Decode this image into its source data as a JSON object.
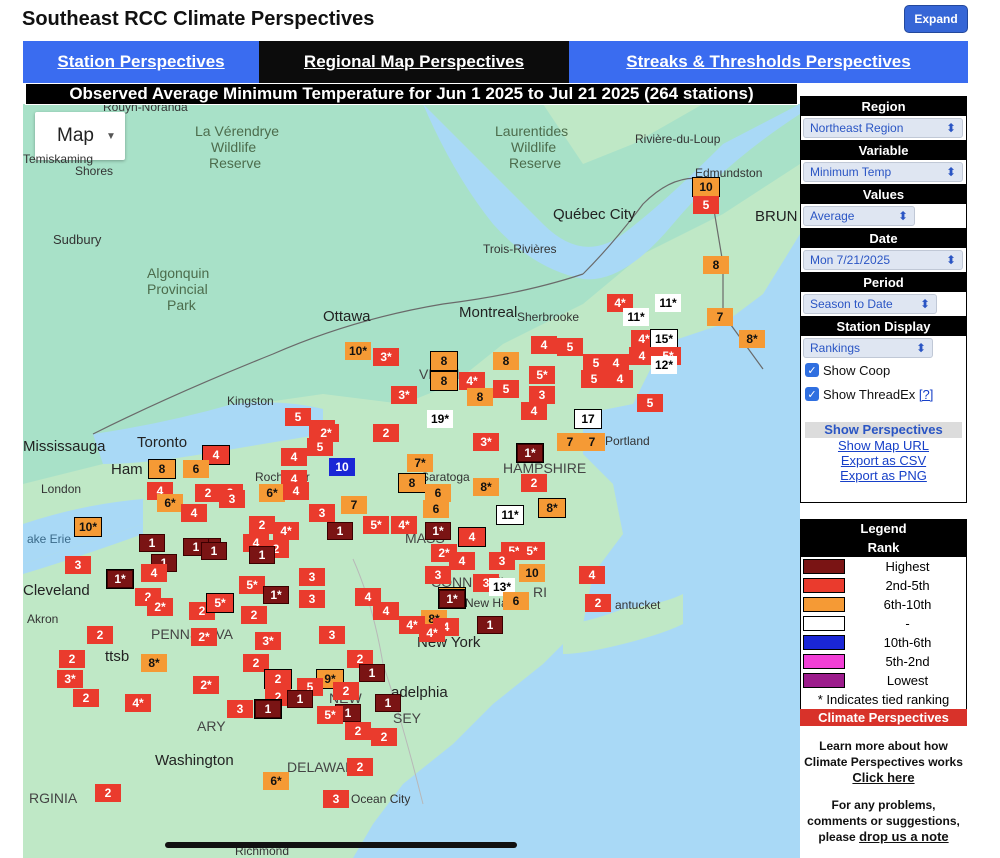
{
  "app": {
    "title": "Southeast RCC Climate Perspectives",
    "expand_label": "Expand"
  },
  "tabs": [
    {
      "label": "Station Perspectives",
      "active": false
    },
    {
      "label": "Regional Map Perspectives",
      "active": true
    },
    {
      "label": "Streaks & Thresholds Perspectives",
      "active": false
    }
  ],
  "map": {
    "title": "Observed Average Minimum Temperature for Jun 1 2025 to Jul 21 2025 (264 stations)",
    "map_type": "Map",
    "places": [
      {
        "label": "La Vérendrye",
        "type": "park"
      },
      {
        "label": "Wildlife",
        "type": "park"
      },
      {
        "label": "Reserve",
        "type": "park"
      },
      {
        "label": "Laurentides",
        "type": "park"
      },
      {
        "label": "Wildlife",
        "type": "park"
      },
      {
        "label": "Reserve",
        "type": "park"
      },
      {
        "label": "Algonquin",
        "type": "park"
      },
      {
        "label": "Provincial",
        "type": "park"
      },
      {
        "label": "Park",
        "type": "park"
      },
      {
        "label": "Rouyn-Noranda",
        "type": "place"
      },
      {
        "label": "Temiskaming",
        "type": "place"
      },
      {
        "label": "Shores",
        "type": "place"
      },
      {
        "label": "Rivière-du-Loup",
        "type": "place"
      },
      {
        "label": "Edmundston",
        "type": "place"
      },
      {
        "label": "Québec City",
        "type": "big"
      },
      {
        "label": "BRUN",
        "type": "big"
      },
      {
        "label": "Sudbury",
        "type": "place"
      },
      {
        "label": "Trois-Rivières",
        "type": "place"
      },
      {
        "label": "Ottawa",
        "type": "big"
      },
      {
        "label": "Montreal",
        "type": "big"
      },
      {
        "label": "Sherbrooke",
        "type": "place"
      },
      {
        "label": "Kingston",
        "type": "place"
      },
      {
        "label": "Mississauga",
        "type": "big"
      },
      {
        "label": "Toronto",
        "type": "big"
      },
      {
        "label": "Ham",
        "type": "big"
      },
      {
        "label": "Rochester",
        "type": "place"
      },
      {
        "label": "London",
        "type": "place"
      },
      {
        "label": "Portland",
        "type": "place"
      },
      {
        "label": "Saratoga",
        "type": "place"
      },
      {
        "label": "HAMPSHIRE",
        "type": "place"
      },
      {
        "label": "MASS",
        "type": "place"
      },
      {
        "label": "CONNECTI",
        "type": "place"
      },
      {
        "label": "RI",
        "type": "place"
      },
      {
        "label": "New Haven",
        "type": "place"
      },
      {
        "label": "antucket",
        "type": "place"
      },
      {
        "label": "Cleveland",
        "type": "big"
      },
      {
        "label": "Akron",
        "type": "place"
      },
      {
        "label": "PENNSYLVA",
        "type": "place"
      },
      {
        "label": "New York",
        "type": "big"
      },
      {
        "label": "adelphia",
        "type": "big"
      },
      {
        "label": "NEW",
        "type": "place"
      },
      {
        "label": "SEY",
        "type": "place"
      },
      {
        "label": "ARY",
        "type": "place"
      },
      {
        "label": "Washington",
        "type": "big"
      },
      {
        "label": "DELAWARE",
        "type": "place"
      },
      {
        "label": "Ocean City",
        "type": "place"
      },
      {
        "label": "RGINIA",
        "type": "place"
      },
      {
        "label": "Richmond",
        "type": "place"
      },
      {
        "label": "VERM",
        "type": "place"
      },
      {
        "label": "ake Erie",
        "type": "place"
      },
      {
        "label": "ttsb",
        "type": "place"
      }
    ],
    "markers": [
      {
        "v": "10",
        "r": 3,
        "b": true
      },
      {
        "v": "5",
        "r": 2,
        "b": false
      },
      {
        "v": "8",
        "r": 3,
        "b": false
      },
      {
        "v": "11*",
        "r": 4,
        "b": false
      },
      {
        "v": "4*",
        "r": 2,
        "b": false
      },
      {
        "v": "11*",
        "r": 4,
        "b": false
      },
      {
        "v": "7",
        "r": 3,
        "b": false
      },
      {
        "v": "8*",
        "r": 3,
        "b": false
      },
      {
        "v": "4*",
        "r": 2,
        "b": false
      },
      {
        "v": "15*",
        "r": 4,
        "b": true
      },
      {
        "v": "4",
        "r": 2,
        "b": false
      },
      {
        "v": "5*",
        "r": 2,
        "b": false
      },
      {
        "v": "12*",
        "r": 4,
        "b": false
      },
      {
        "v": "10*",
        "r": 3,
        "b": false
      },
      {
        "v": "3*",
        "r": 2,
        "b": false
      },
      {
        "v": "8",
        "r": 3,
        "b": true
      },
      {
        "v": "8",
        "r": 3,
        "b": false
      },
      {
        "v": "4",
        "r": 2,
        "b": false
      },
      {
        "v": "5",
        "r": 2,
        "b": false
      },
      {
        "v": "8",
        "r": 3,
        "b": true
      },
      {
        "v": "4*",
        "r": 2,
        "b": false
      },
      {
        "v": "5",
        "r": 2,
        "b": false
      },
      {
        "v": "5*",
        "r": 2,
        "b": false
      },
      {
        "v": "5",
        "r": 2,
        "b": false
      },
      {
        "v": "4",
        "r": 2,
        "b": false
      },
      {
        "v": "5",
        "r": 2,
        "b": false
      },
      {
        "v": "4",
        "r": 2,
        "b": false
      },
      {
        "v": "3*",
        "r": 2,
        "b": false
      },
      {
        "v": "8",
        "r": 3,
        "b": false
      },
      {
        "v": "3",
        "r": 2,
        "b": false
      },
      {
        "v": "4",
        "r": 2,
        "b": false
      },
      {
        "v": "5",
        "r": 2,
        "b": false
      },
      {
        "v": "19*",
        "r": 4,
        "b": false
      },
      {
        "v": "3",
        "r": 2,
        "b": false
      },
      {
        "v": "17",
        "r": 4,
        "b": true
      },
      {
        "v": "5",
        "r": 2,
        "b": false
      },
      {
        "v": "5",
        "r": 2,
        "b": false
      },
      {
        "v": "2*",
        "r": 2,
        "b": false
      },
      {
        "v": "5",
        "r": 2,
        "b": false
      },
      {
        "v": "2",
        "r": 2,
        "b": false
      },
      {
        "v": "3*",
        "r": 2,
        "b": false
      },
      {
        "v": "1*",
        "r": 1,
        "b": true
      },
      {
        "v": "7",
        "r": 3,
        "b": false
      },
      {
        "v": "7",
        "r": 3,
        "b": false
      },
      {
        "v": "10",
        "r": 5,
        "b": false
      },
      {
        "v": "4",
        "r": 2,
        "b": true
      },
      {
        "v": "8",
        "r": 3,
        "b": true
      },
      {
        "v": "6",
        "r": 3,
        "b": false
      },
      {
        "v": "4",
        "r": 2,
        "b": false
      },
      {
        "v": "7*",
        "r": 3,
        "b": false
      },
      {
        "v": "4",
        "r": 2,
        "b": false
      },
      {
        "v": "2",
        "r": 2,
        "b": false
      },
      {
        "v": "8",
        "r": 3,
        "b": true
      },
      {
        "v": "6*",
        "r": 3,
        "b": false
      },
      {
        "v": "4",
        "r": 2,
        "b": false
      },
      {
        "v": "4",
        "r": 2,
        "b": false
      },
      {
        "v": "8*",
        "r": 3,
        "b": false
      },
      {
        "v": "6",
        "r": 3,
        "b": false
      },
      {
        "v": "2",
        "r": 2,
        "b": false
      },
      {
        "v": "2",
        "r": 2,
        "b": false
      },
      {
        "v": "3",
        "r": 2,
        "b": false
      },
      {
        "v": "6*",
        "r": 3,
        "b": false
      },
      {
        "v": "7",
        "r": 3,
        "b": false
      },
      {
        "v": "6",
        "r": 3,
        "b": false
      },
      {
        "v": "4",
        "r": 2,
        "b": false
      },
      {
        "v": "3",
        "r": 2,
        "b": false
      },
      {
        "v": "10*",
        "r": 3,
        "b": true
      },
      {
        "v": "11*",
        "r": 4,
        "b": true
      },
      {
        "v": "8*",
        "r": 3,
        "b": true
      },
      {
        "v": "1",
        "r": 1,
        "b": false
      },
      {
        "v": "4",
        "r": 2,
        "b": true
      },
      {
        "v": "1*",
        "r": 1,
        "b": false
      },
      {
        "v": "5*",
        "r": 2,
        "b": false
      },
      {
        "v": "4*",
        "r": 2,
        "b": false
      },
      {
        "v": "2",
        "r": 2,
        "b": false
      },
      {
        "v": "4*",
        "r": 2,
        "b": false
      },
      {
        "v": "1",
        "r": 1,
        "b": false
      },
      {
        "v": "4",
        "r": 2,
        "b": false
      },
      {
        "v": "5*",
        "r": 2,
        "b": false
      },
      {
        "v": "2*",
        "r": 2,
        "b": false
      },
      {
        "v": "4",
        "r": 2,
        "b": false
      },
      {
        "v": "3",
        "r": 2,
        "b": false
      },
      {
        "v": "5*",
        "r": 2,
        "b": false
      },
      {
        "v": "3",
        "r": 2,
        "b": false
      },
      {
        "v": "10",
        "r": 3,
        "b": false
      },
      {
        "v": "4",
        "r": 2,
        "b": false
      },
      {
        "v": "3",
        "r": 2,
        "b": false
      },
      {
        "v": "13*",
        "r": 4,
        "b": false
      },
      {
        "v": "2",
        "r": 2,
        "b": false
      },
      {
        "v": "6",
        "r": 3,
        "b": true
      },
      {
        "v": "6",
        "r": 3,
        "b": false
      },
      {
        "v": "3",
        "r": 2,
        "b": false
      },
      {
        "v": "3",
        "r": 2,
        "b": false
      },
      {
        "v": "4",
        "r": 2,
        "b": false
      },
      {
        "v": "1*",
        "r": 1,
        "b": true
      },
      {
        "v": "8*",
        "r": 3,
        "b": false
      },
      {
        "v": "4*",
        "r": 2,
        "b": false
      },
      {
        "v": "4",
        "r": 2,
        "b": false
      },
      {
        "v": "4*",
        "r": 2,
        "b": false
      },
      {
        "v": "1",
        "r": 1,
        "b": false
      },
      {
        "v": "1",
        "r": 1,
        "b": false
      },
      {
        "v": "1",
        "r": 1,
        "b": false
      },
      {
        "v": "1",
        "r": 1,
        "b": false
      },
      {
        "v": "1",
        "r": 1,
        "b": false
      },
      {
        "v": "4",
        "r": 2,
        "b": false
      },
      {
        "v": "2",
        "r": 2,
        "b": false
      },
      {
        "v": "1",
        "r": 1,
        "b": false
      },
      {
        "v": "3",
        "r": 2,
        "b": false
      },
      {
        "v": "1*",
        "r": 1,
        "b": true
      },
      {
        "v": "5*",
        "r": 2,
        "b": false
      },
      {
        "v": "1*",
        "r": 1,
        "b": false
      },
      {
        "v": "2",
        "r": 2,
        "b": false
      },
      {
        "v": "2*",
        "r": 2,
        "b": false
      },
      {
        "v": "2",
        "r": 2,
        "b": false
      },
      {
        "v": "5*",
        "r": 2,
        "b": true
      },
      {
        "v": "2",
        "r": 2,
        "b": false
      },
      {
        "v": "4",
        "r": 2,
        "b": false
      },
      {
        "v": "2",
        "r": 2,
        "b": false
      },
      {
        "v": "2*",
        "r": 2,
        "b": false
      },
      {
        "v": "3",
        "r": 2,
        "b": false
      },
      {
        "v": "3*",
        "r": 2,
        "b": false
      },
      {
        "v": "2",
        "r": 2,
        "b": false
      },
      {
        "v": "8*",
        "r": 3,
        "b": false
      },
      {
        "v": "2",
        "r": 2,
        "b": false
      },
      {
        "v": "2",
        "r": 2,
        "b": false
      },
      {
        "v": "1",
        "r": 1,
        "b": false
      },
      {
        "v": "9*",
        "r": 3,
        "b": true
      },
      {
        "v": "2*",
        "r": 2,
        "b": false
      },
      {
        "v": "2",
        "r": 2,
        "b": true
      },
      {
        "v": "5",
        "r": 2,
        "b": false
      },
      {
        "v": "2",
        "r": 2,
        "b": false
      },
      {
        "v": "2",
        "r": 2,
        "b": false
      },
      {
        "v": "1",
        "r": 1,
        "b": false
      },
      {
        "v": "3*",
        "r": 2,
        "b": false
      },
      {
        "v": "2",
        "r": 2,
        "b": false
      },
      {
        "v": "4*",
        "r": 2,
        "b": false
      },
      {
        "v": "3",
        "r": 2,
        "b": false
      },
      {
        "v": "1",
        "r": 1,
        "b": false
      },
      {
        "v": "1",
        "r": 1,
        "b": true
      },
      {
        "v": "1",
        "r": 1,
        "b": false
      },
      {
        "v": "2",
        "r": 2,
        "b": false
      },
      {
        "v": "2",
        "r": 2,
        "b": false
      },
      {
        "v": "5*",
        "r": 2,
        "b": false
      },
      {
        "v": "2",
        "r": 2,
        "b": false
      },
      {
        "v": "6*",
        "r": 3,
        "b": false
      },
      {
        "v": "3",
        "r": 2,
        "b": false
      },
      {
        "v": "2",
        "r": 2,
        "b": false
      }
    ]
  },
  "sidebar": {
    "region": {
      "header": "Region",
      "value": "Northeast Region"
    },
    "variable": {
      "header": "Variable",
      "value": "Minimum Temp"
    },
    "values": {
      "header": "Values",
      "value": "Average"
    },
    "date": {
      "header": "Date",
      "value": "Mon 7/21/2025"
    },
    "period": {
      "header": "Period",
      "value": "Season to Date"
    },
    "station_display": {
      "header": "Station Display",
      "value": "Rankings"
    },
    "show_coop": "Show Coop",
    "show_threadex": "Show ThreadEx",
    "help_link": "[?]",
    "show_perspectives": "Show Perspectives",
    "links": [
      "Show Map URL",
      "Export as CSV",
      "Export as PNG"
    ]
  },
  "legend": {
    "title": "Legend",
    "subtitle": "Rank",
    "items": [
      {
        "label": "Highest",
        "color": "#7a1414"
      },
      {
        "label": "2nd-5th",
        "color": "#ea3b2d"
      },
      {
        "label": "6th-10th",
        "color": "#f59a35"
      },
      {
        "label": "-",
        "color": "#ffffff"
      },
      {
        "label": "10th-6th",
        "color": "#1a26d6"
      },
      {
        "label": "5th-2nd",
        "color": "#f23fd6"
      },
      {
        "label": "Lowest",
        "color": "#9c1c8c"
      }
    ],
    "note": "* Indicates tied ranking",
    "footer": "Climate Perspectives"
  },
  "info": {
    "learn_text": "Learn more about how Climate Perspectives works",
    "learn_link": "Click here",
    "problems_text": "For any problems, comments or suggestions, please",
    "problems_link": "drop us a note"
  }
}
